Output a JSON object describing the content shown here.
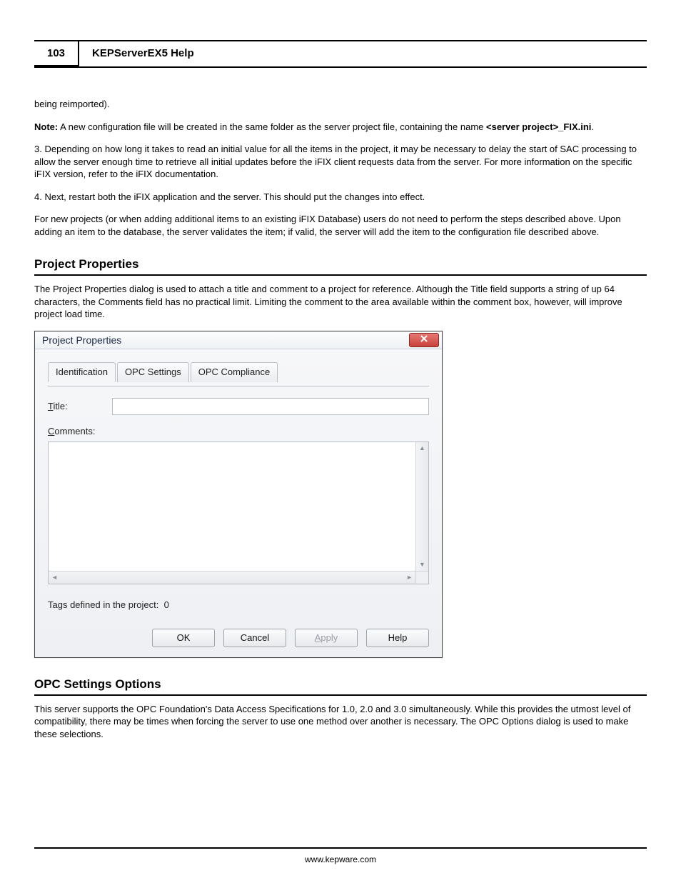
{
  "page_number": "103",
  "doc_title": "KEPServerEX5 Help",
  "para_intro_tail": "being reimported).",
  "note_label": "Note:",
  "note_text": " A new configuration file will be created in the same folder as the server project file, containing the name ",
  "note_filename": "<server project>_FIX.ini",
  "note_period": ".",
  "step3": "3. Depending on how long it takes to read an initial value for all the items in the project, it may be necessary to delay the start of SAC processing to allow the server enough time to retrieve all initial updates before the iFIX client requests data from the server. For more information on the specific iFIX version, refer to the iFIX documentation.",
  "step4": "4. Next, restart both the iFIX application and the server. This should put the changes into effect.",
  "para_newprojects": "For new projects (or when adding additional items to an existing iFIX Database) users do not need to perform the steps described above. Upon adding an item to the database, the server validates the item; if valid, the server will add the item to the configuration file described above.",
  "section_project_properties": "Project Properties",
  "project_properties_desc": "The Project Properties dialog is used to attach a title and comment to a project for reference. Although the Title field supports a string of up 64 characters, the Comments field has no practical limit. Limiting the comment to the area available within the comment box, however, will improve project load time.",
  "dialog": {
    "title": "Project Properties",
    "tabs": {
      "identification": "Identification",
      "opc_settings": "OPC Settings",
      "opc_compliance": "OPC Compliance"
    },
    "title_label_pre": "T",
    "title_label_post": "itle:",
    "comments_label_pre": "C",
    "comments_label_post": "omments:",
    "tags_label": "Tags defined in the project:",
    "tags_count": "0",
    "buttons": {
      "ok": "OK",
      "cancel": "Cancel",
      "apply_pre": "A",
      "apply_post": "pply",
      "help": "Help"
    }
  },
  "section_opc_settings": "OPC Settings Options",
  "opc_settings_desc": "This server supports the OPC Foundation's Data Access Specifications for 1.0, 2.0 and 3.0 simultaneously. While this provides the utmost level of compatibility, there may be times when forcing the server to use one method over another is necessary. The OPC Options dialog is used to make these selections.",
  "footer_url": "www.kepware.com"
}
